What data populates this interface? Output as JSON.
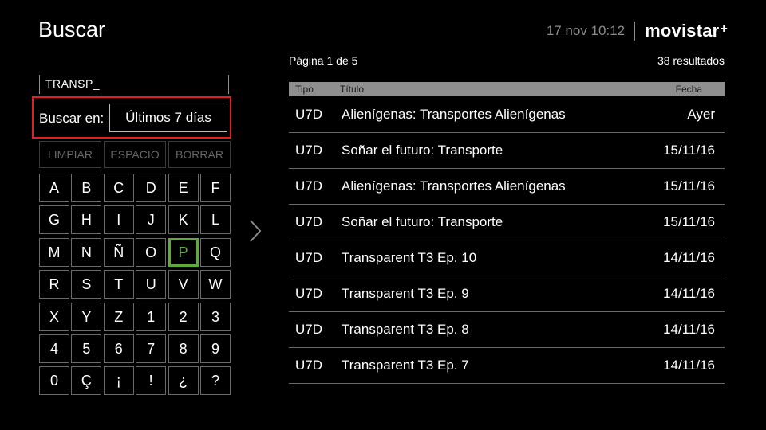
{
  "header": {
    "title": "Buscar",
    "datetime": "17 nov 10:12",
    "brand": "movistar",
    "brand_plus": "+"
  },
  "search": {
    "query": "TRANSP_",
    "filter_label": "Buscar en:",
    "filter_value": "Últimos 7 días"
  },
  "actions": [
    "LIMPIAR",
    "ESPACIO",
    "BORRAR"
  ],
  "keyboard": {
    "keys": [
      "A",
      "B",
      "C",
      "D",
      "E",
      "F",
      "G",
      "H",
      "I",
      "J",
      "K",
      "L",
      "M",
      "N",
      "Ñ",
      "O",
      "P",
      "Q",
      "R",
      "S",
      "T",
      "U",
      "V",
      "W",
      "X",
      "Y",
      "Z",
      "1",
      "2",
      "3",
      "4",
      "5",
      "6",
      "7",
      "8",
      "9",
      "0",
      "Ç",
      "¡",
      "!",
      "¿",
      "?"
    ],
    "selected": "P"
  },
  "results": {
    "page_info": "Página 1 de 5",
    "count": "38 resultados",
    "columns": {
      "tipo": "Tipo",
      "titulo": "Título",
      "fecha": "Fecha"
    },
    "rows": [
      {
        "tipo": "U7D",
        "titulo": "Alienígenas: Transportes Alienígenas",
        "fecha": "Ayer"
      },
      {
        "tipo": "U7D",
        "titulo": "Soñar el futuro: Transporte",
        "fecha": "15/11/16"
      },
      {
        "tipo": "U7D",
        "titulo": "Alienígenas: Transportes Alienígenas",
        "fecha": "15/11/16"
      },
      {
        "tipo": "U7D",
        "titulo": "Soñar el futuro: Transporte",
        "fecha": "15/11/16"
      },
      {
        "tipo": "U7D",
        "titulo": "Transparent T3 Ep. 10",
        "fecha": "14/11/16"
      },
      {
        "tipo": "U7D",
        "titulo": "Transparent T3 Ep. 9",
        "fecha": "14/11/16"
      },
      {
        "tipo": "U7D",
        "titulo": "Transparent T3 Ep. 8",
        "fecha": "14/11/16"
      },
      {
        "tipo": "U7D",
        "titulo": "Transparent T3 Ep. 7",
        "fecha": "14/11/16"
      }
    ]
  },
  "icons": {
    "next_panel": "chevron-right-icon"
  },
  "colors": {
    "focus": "#5dab3a",
    "highlight": "#e02020",
    "header_bar": "#8f8f8f"
  }
}
